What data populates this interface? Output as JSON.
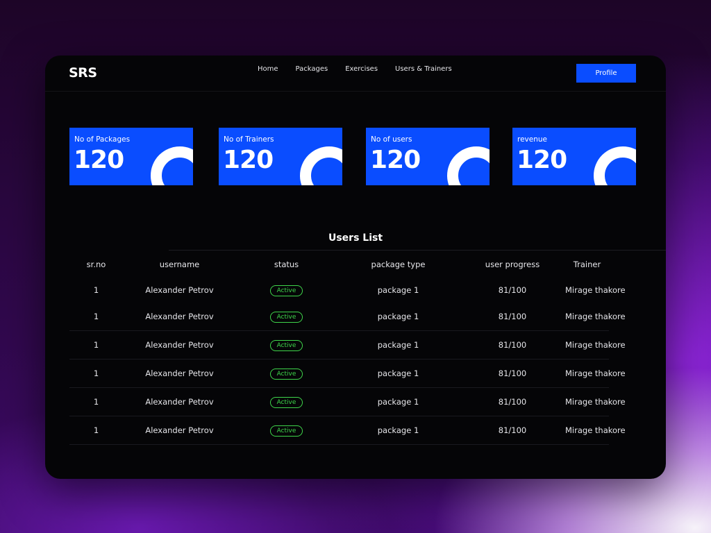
{
  "app": {
    "logo": "SRS"
  },
  "nav": {
    "links": [
      "Home",
      "Packages",
      "Exercises",
      "Users & Trainers"
    ],
    "profile_label": "Profile"
  },
  "stats": [
    {
      "label": "No of Packages",
      "value": "120"
    },
    {
      "label": "No of Trainers",
      "value": "120"
    },
    {
      "label": "No of users",
      "value": "120"
    },
    {
      "label": "revenue",
      "value": "120"
    }
  ],
  "users_list": {
    "title": "Users List",
    "columns": [
      "sr.no",
      "username",
      "status",
      "package type",
      "user progress",
      "Trainer"
    ],
    "rows": [
      {
        "sr_no": "1",
        "username": "Alexander Petrov",
        "status": "Active",
        "package_type": "package 1",
        "progress": "81/100",
        "trainer": "Mirage thakore"
      },
      {
        "sr_no": "1",
        "username": "Alexander Petrov",
        "status": "Active",
        "package_type": "package 1",
        "progress": "81/100",
        "trainer": "Mirage thakore"
      },
      {
        "sr_no": "1",
        "username": "Alexander Petrov",
        "status": "Active",
        "package_type": "package 1",
        "progress": "81/100",
        "trainer": "Mirage thakore"
      },
      {
        "sr_no": "1",
        "username": "Alexander Petrov",
        "status": "Active",
        "package_type": "package 1",
        "progress": "81/100",
        "trainer": "Mirage thakore"
      },
      {
        "sr_no": "1",
        "username": "Alexander Petrov",
        "status": "Active",
        "package_type": "package 1",
        "progress": "81/100",
        "trainer": "Mirage thakore"
      },
      {
        "sr_no": "1",
        "username": "Alexander Petrov",
        "status": "Active",
        "package_type": "package 1",
        "progress": "81/100",
        "trainer": "Mirage thakore"
      }
    ]
  },
  "colors": {
    "accent": "#0a4dff",
    "status_active": "#3fd64b",
    "panel_bg": "#050507"
  },
  "icons": {
    "stat_card": "ring-graphic"
  }
}
